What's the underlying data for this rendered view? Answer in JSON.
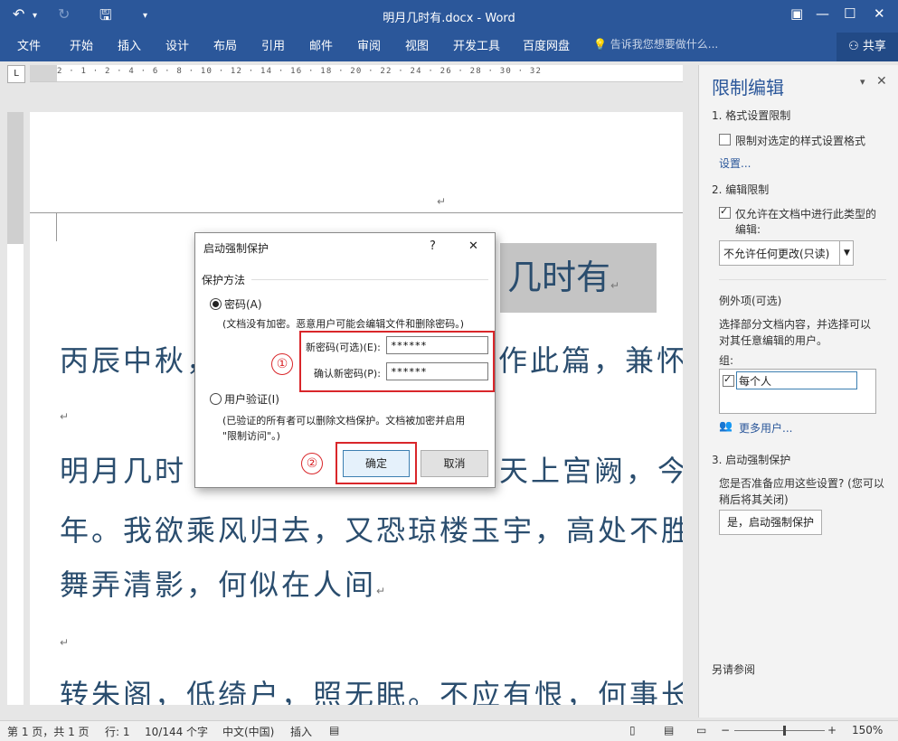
{
  "titlebar": {
    "title": "明月几时有.docx - Word",
    "undo_icon": "undo-icon",
    "redo_icon": "redo-icon",
    "save_icon": "save-icon",
    "customize_icon": "dropdown-icon"
  },
  "tabs": [
    "文件",
    "开始",
    "插入",
    "设计",
    "布局",
    "引用",
    "邮件",
    "审阅",
    "视图",
    "开发工具",
    "百度网盘"
  ],
  "tell_me": "告诉我您想要做什么...",
  "share": "共享",
  "ruler": {
    "corner": "L",
    "marks": "2 · 1 · 2 · 4 · 6 · 8 · 10 · 12 · 14 · 16 · 18 · 20 · 22 · 24 · 26 · 28 · 30 · 32"
  },
  "document": {
    "title_text": "几时有",
    "line1": "丙辰中秋，",
    "line1_tail": "作此篇，兼怀子",
    "line2": "明月几时",
    "line2_tail": "知天上宫阙，今",
    "line3": "年。我欲乘风归去，又恐琼楼玉宇，高处不胜",
    "line4": "舞弄清影，何似在人间",
    "line5": "转朱阁，低绮户，照无眠。不应有恨，何事长",
    "para_mark": "↵"
  },
  "dialog": {
    "title": "启动强制保护",
    "help": "?",
    "close": "✕",
    "section": "保护方法",
    "radio_password": "密码(A)",
    "password_note": "(文档没有加密。恶意用户可能会编辑文件和删除密码。)",
    "new_password_label": "新密码(可选)(E):",
    "new_password_value": "******",
    "confirm_password_label": "确认新密码(P):",
    "confirm_password_value": "******",
    "radio_user": "用户验证(I)",
    "user_note_1": "(已验证的所有者可以删除文档保护。文档被加密并启用",
    "user_note_2": "\"限制访问\"。)",
    "ok": "确定",
    "cancel": "取消",
    "callout_1": "①",
    "callout_2": "②"
  },
  "pane": {
    "title": "限制编辑",
    "s1": "1. 格式设置限制",
    "s1_check": "限制对选定的样式设置格式",
    "s1_link": "设置...",
    "s2": "2. 编辑限制",
    "s2_check_1": "仅允许在文档中进行此类型的",
    "s2_check_2": "编辑:",
    "s2_select": "不允许任何更改(只读)",
    "exceptions": "例外项(可选)",
    "exc_desc_1": "选择部分文档内容，并选择可以",
    "exc_desc_2": "对其任意编辑的用户。",
    "group_label": "组:",
    "group_item": "每个人",
    "more_users": "更多用户...",
    "s3": "3. 启动强制保护",
    "s3_desc_1": "您是否准备应用这些设置? (您可以",
    "s3_desc_2": "稍后将其关闭)",
    "s3_button": "是，启动强制保护",
    "see_also": "另请参阅"
  },
  "status": {
    "page": "第 1 页，共 1 页",
    "line": "行: 1",
    "words": "10/144 个字",
    "lang": "中文(中国)",
    "mode": "插入",
    "zoom": "150%"
  },
  "colors": {
    "brand": "#2b579a",
    "highlight_red": "#d9262a"
  }
}
